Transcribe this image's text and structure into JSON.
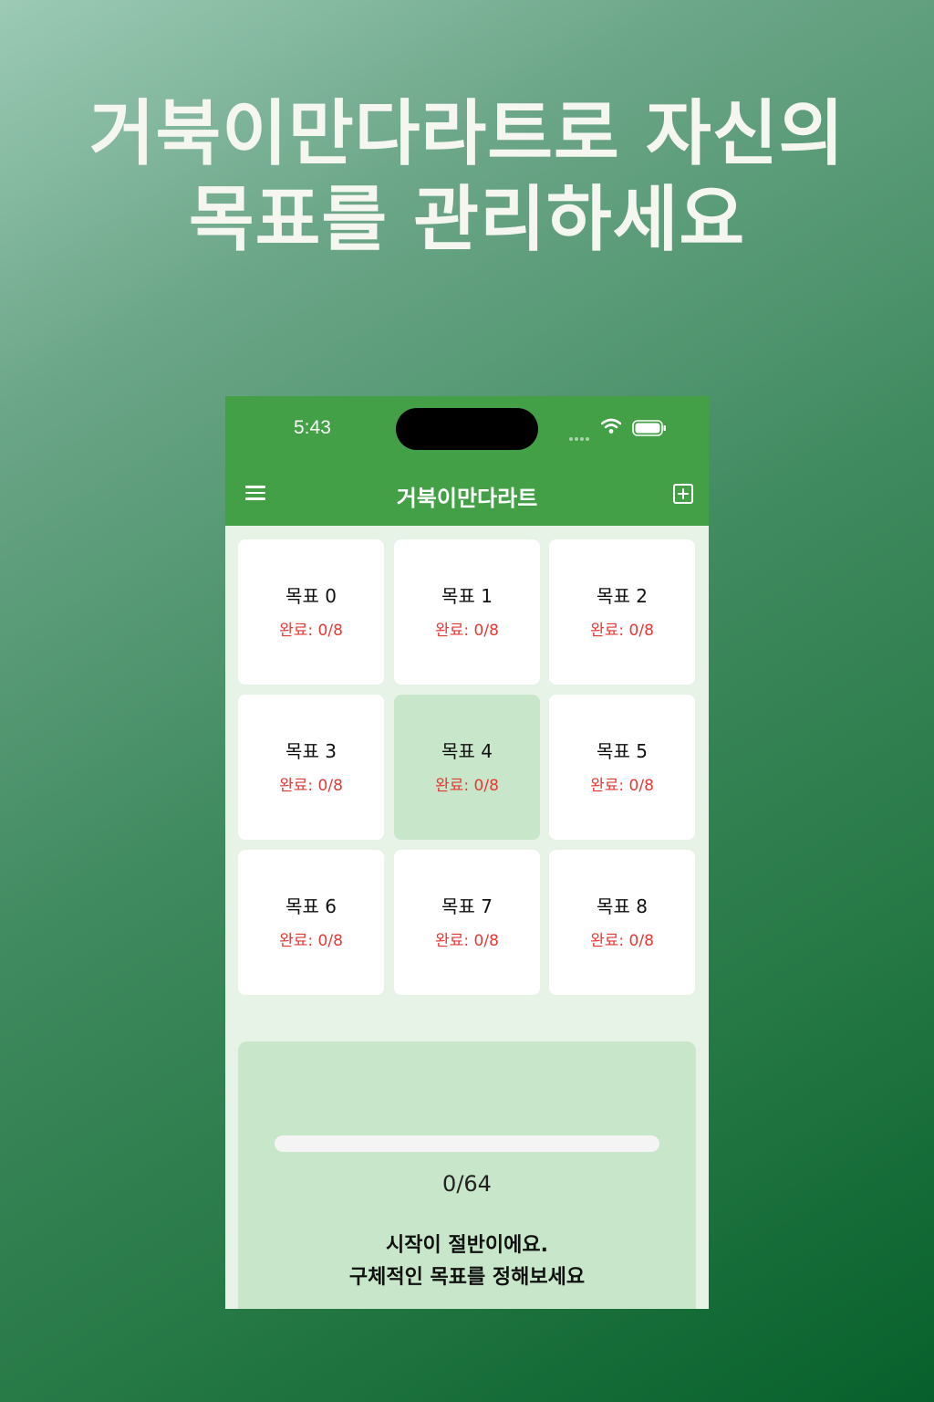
{
  "headline": {
    "line1": "거북이만다라트로 자신의",
    "line2": "목표를 관리하세요"
  },
  "statusbar": {
    "time": "5:43",
    "icons": [
      "cellular-signal-icon",
      "wifi-icon",
      "battery-icon"
    ]
  },
  "appbar": {
    "title": "거북이만다라트",
    "left_icon": "hamburger-menu-icon",
    "right_icon": "add-box-icon"
  },
  "grid": {
    "cells": [
      {
        "title": "목표 0",
        "status": "완료: 0/8"
      },
      {
        "title": "목표 1",
        "status": "완료: 0/8"
      },
      {
        "title": "목표 2",
        "status": "완료: 0/8"
      },
      {
        "title": "목표 3",
        "status": "완료: 0/8"
      },
      {
        "title": "목표 4",
        "status": "완료: 0/8"
      },
      {
        "title": "목표 5",
        "status": "완료: 0/8"
      },
      {
        "title": "목표 6",
        "status": "완료: 0/8"
      },
      {
        "title": "목표 7",
        "status": "완료: 0/8"
      },
      {
        "title": "목표 8",
        "status": "완료: 0/8"
      }
    ]
  },
  "progress": {
    "count_text": "0/64",
    "fraction": 0,
    "message_line1": "시작이 절반이에요.",
    "message_line2": "구체적인 목표를 정해보세요"
  },
  "colors": {
    "appbar": "#43a047",
    "center_cell": "#c8e6c9",
    "status_red": "#e53935",
    "background": "#e8f3e8"
  }
}
